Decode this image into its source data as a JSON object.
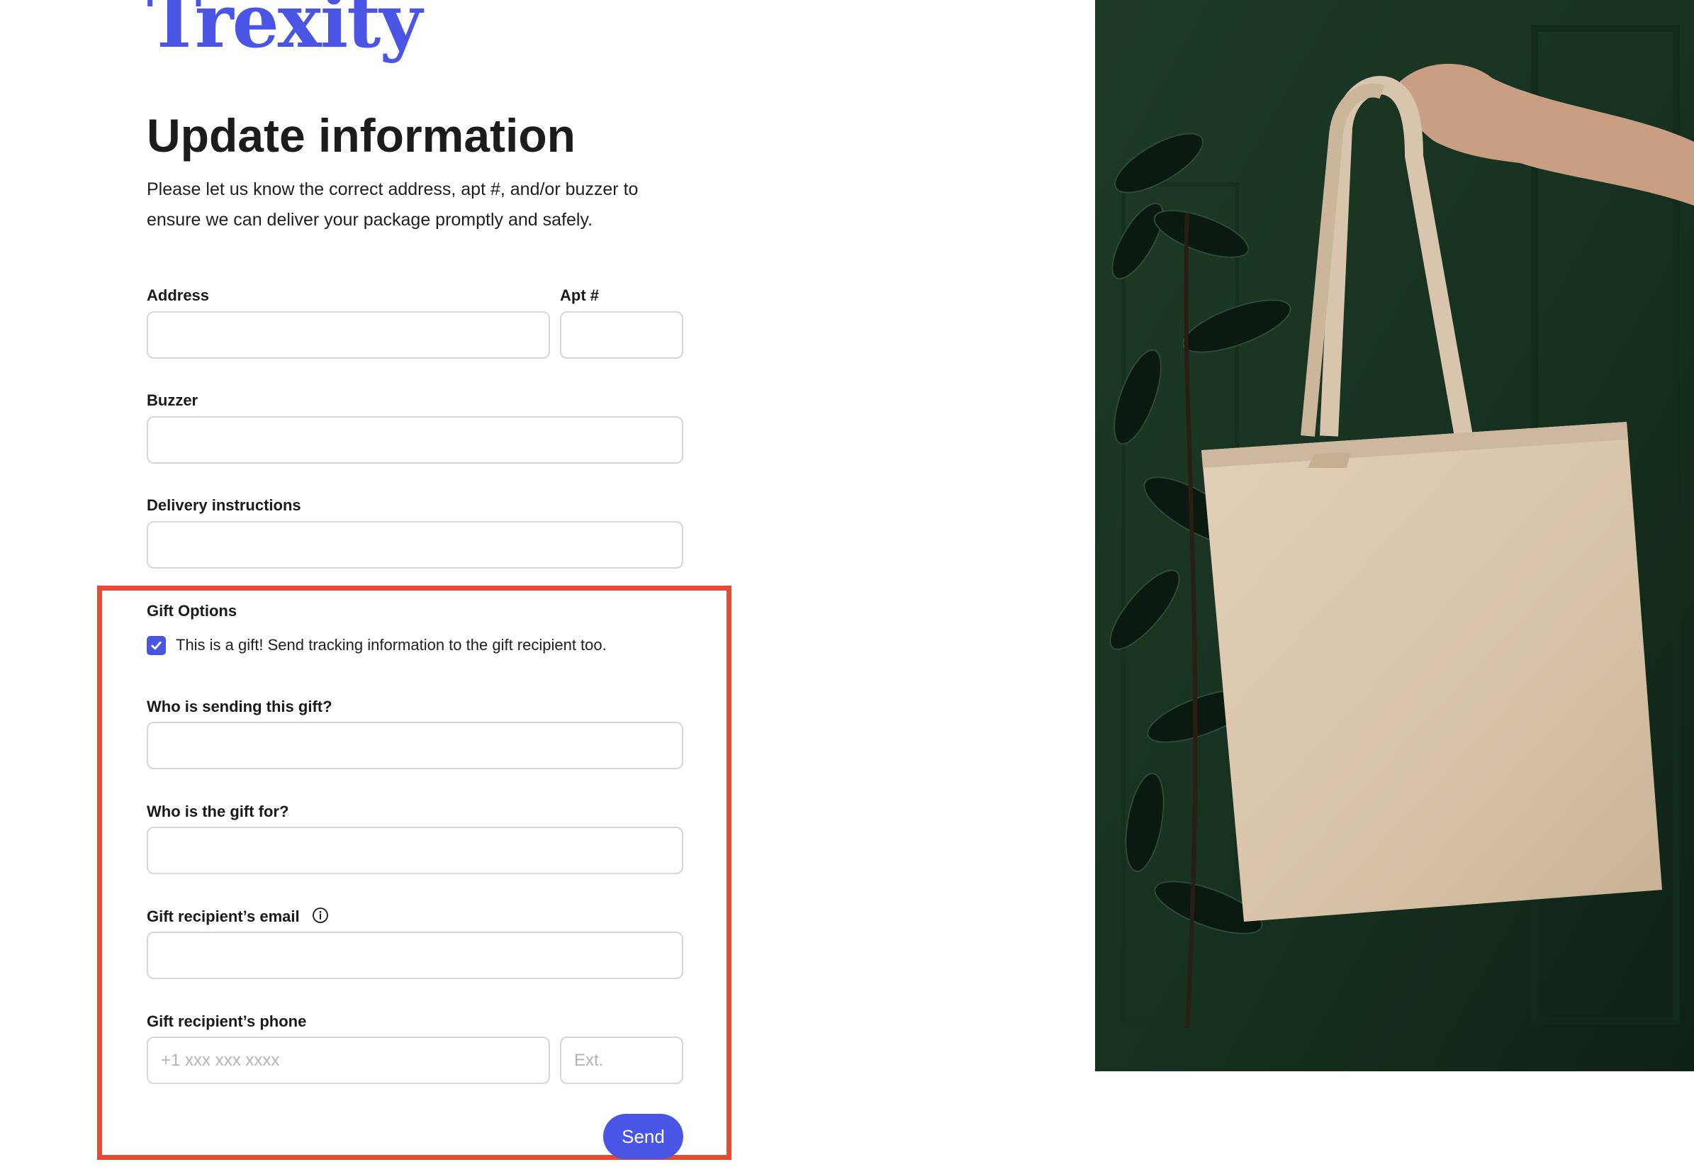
{
  "brand": {
    "logo_text": "Trexity",
    "accent_color": "#4a55e6"
  },
  "header": {
    "title": "Update information",
    "subtitle": "Please let us know the correct address, apt #, and/or buzzer to ensure we can deliver your package promptly and safely."
  },
  "form": {
    "address_label": "Address",
    "address_value": "",
    "apt_label": "Apt #",
    "apt_value": "",
    "buzzer_label": "Buzzer",
    "buzzer_value": "",
    "delivery_label": "Delivery instructions",
    "delivery_value": ""
  },
  "gift": {
    "section_label": "Gift Options",
    "checkbox_label": "This is a gift! Send tracking information to the gift recipient too.",
    "checkbox_checked": true,
    "sender_label": "Who is sending this gift?",
    "recipient_label": "Who is the gift for?",
    "email_label": "Gift recipient’s email",
    "phone_label": "Gift recipient’s phone",
    "phone_placeholder": "+1 xxx xxx xxxx",
    "ext_placeholder": "Ext.",
    "highlight_color": "#e64a32"
  },
  "actions": {
    "send_label": "Send"
  },
  "icons": {
    "checkbox": "checkmark-icon",
    "email_info": "info-icon"
  },
  "hero_image": {
    "description_icon": "tote-bag-photo"
  }
}
